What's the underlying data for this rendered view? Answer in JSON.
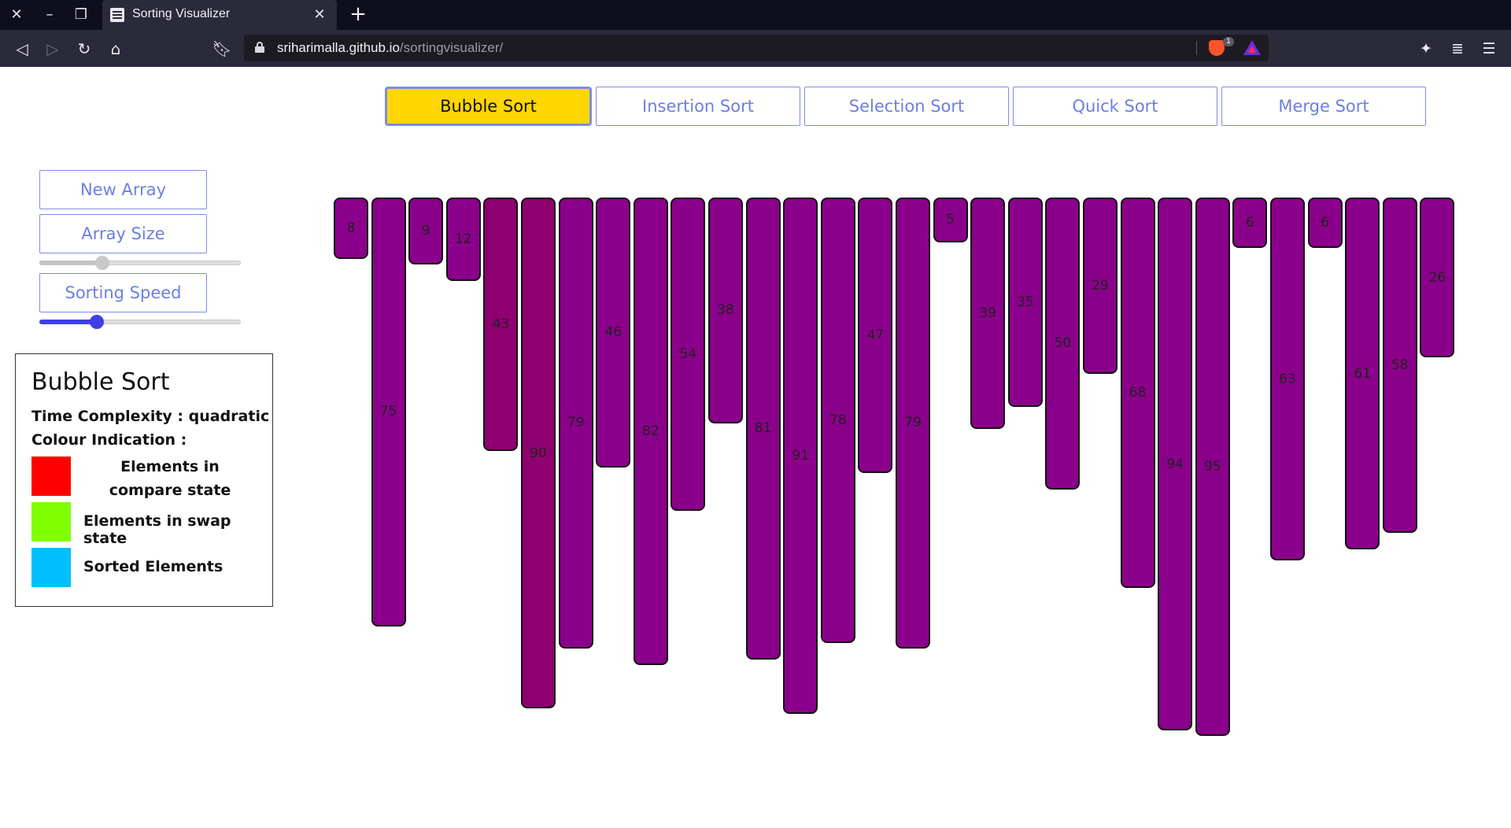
{
  "browser": {
    "tab_title": "Sorting Visualizer",
    "url_host": "sriharimalla.github.io",
    "url_path": "/sortingvisualizer/",
    "brave_badge": "1"
  },
  "algorithms": [
    {
      "label": "Bubble Sort",
      "active": true
    },
    {
      "label": "Insertion Sort",
      "active": false
    },
    {
      "label": "Selection Sort",
      "active": false
    },
    {
      "label": "Quick Sort",
      "active": false
    },
    {
      "label": "Merge Sort",
      "active": false
    }
  ],
  "controls": {
    "new_array": "New Array",
    "array_size": "Array Size",
    "sorting_speed": "Sorting Speed",
    "array_size_value": 0.3,
    "sorting_speed_value": 0.27
  },
  "info": {
    "title": "Bubble Sort",
    "time_complexity": "Time Complexity : quadratic",
    "colour_heading": "Colour Indication :",
    "legend": [
      {
        "label": "Elements in compare state",
        "color": "#ff0000"
      },
      {
        "label": "Elements in swap state",
        "color": "#7fff00"
      },
      {
        "label": "Sorted Elements",
        "color": "#00bfff"
      }
    ]
  },
  "colors": {
    "bar": "#8b008b",
    "bar_compare": "#8e0070",
    "active_button": "#ffd600",
    "button_text": "#6b7fe3"
  },
  "array": [
    8,
    75,
    9,
    12,
    43,
    90,
    79,
    46,
    82,
    54,
    38,
    81,
    91,
    78,
    47,
    79,
    5,
    39,
    35,
    50,
    29,
    68,
    94,
    95,
    6,
    63,
    6,
    61,
    58,
    26
  ],
  "compare_indices": [
    4,
    5
  ]
}
